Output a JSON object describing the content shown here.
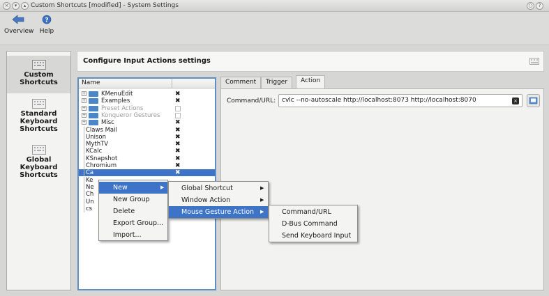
{
  "window": {
    "title": "Custom Shortcuts [modified] - System Settings"
  },
  "toolbar": {
    "overview_label": "Overview",
    "help_label": "Help"
  },
  "sidebar": {
    "items": [
      {
        "label": "Custom Shortcuts",
        "selected": true
      },
      {
        "label": "Standard Keyboard Shortcuts",
        "selected": false
      },
      {
        "label": "Global Keyboard Shortcuts",
        "selected": false
      }
    ]
  },
  "main": {
    "title": "Configure Input Actions settings"
  },
  "tree": {
    "column_name": "Name",
    "rows": [
      {
        "label": "KMenuEdit",
        "group": true,
        "mark": "x"
      },
      {
        "label": "Examples",
        "group": true,
        "mark": "x"
      },
      {
        "label": "Preset Actions",
        "group": true,
        "mark": "box",
        "dim": true
      },
      {
        "label": "Konqueror Gestures",
        "group": true,
        "mark": "box",
        "dim": true
      },
      {
        "label": "Misc",
        "group": true,
        "mark": "x"
      },
      {
        "label": "Claws Mail",
        "group": false,
        "mark": "x"
      },
      {
        "label": "Unison",
        "group": false,
        "mark": "x"
      },
      {
        "label": "MythTV",
        "group": false,
        "mark": "x"
      },
      {
        "label": "KCalc",
        "group": false,
        "mark": "x"
      },
      {
        "label": "KSnapshot",
        "group": false,
        "mark": "x"
      },
      {
        "label": "Chromium",
        "group": false,
        "mark": "x"
      },
      {
        "label": "Ca",
        "group": false,
        "mark": "x",
        "highlight": true
      },
      {
        "label": "Ke",
        "group": false,
        "mark": ""
      },
      {
        "label": "Ne",
        "group": false,
        "mark": ""
      },
      {
        "label": "Ch",
        "group": false,
        "mark": ""
      },
      {
        "label": "Un",
        "group": false,
        "mark": ""
      },
      {
        "label": "cs",
        "group": false,
        "mark": "x"
      }
    ]
  },
  "tabs": [
    {
      "label": "Comment",
      "active": false
    },
    {
      "label": "Trigger",
      "active": false
    },
    {
      "label": "Action",
      "active": true
    }
  ],
  "action": {
    "command_label": "Command/URL:",
    "command_value": "cvlc --no-autoscale http://localhost:8073 http://localhost:8070"
  },
  "context_menu": {
    "items": [
      {
        "label": "New",
        "submenu": true,
        "selected": true
      },
      {
        "label": "New Group"
      },
      {
        "label": "Delete"
      },
      {
        "label": "Export Group..."
      },
      {
        "label": "Import..."
      }
    ]
  },
  "new_submenu": {
    "items": [
      {
        "label": "Global Shortcut",
        "submenu": true
      },
      {
        "label": "Window Action",
        "submenu": true
      },
      {
        "label": "Mouse Gesture Action",
        "submenu": true,
        "selected": true
      }
    ]
  },
  "gesture_submenu": {
    "items": [
      {
        "label": "Command/URL"
      },
      {
        "label": "D-Bus Command"
      },
      {
        "label": "Send Keyboard Input"
      }
    ]
  },
  "colors": {
    "selection": "#3d74c7",
    "folder": "#4a86c8",
    "focus_border": "#5f8dc6"
  }
}
